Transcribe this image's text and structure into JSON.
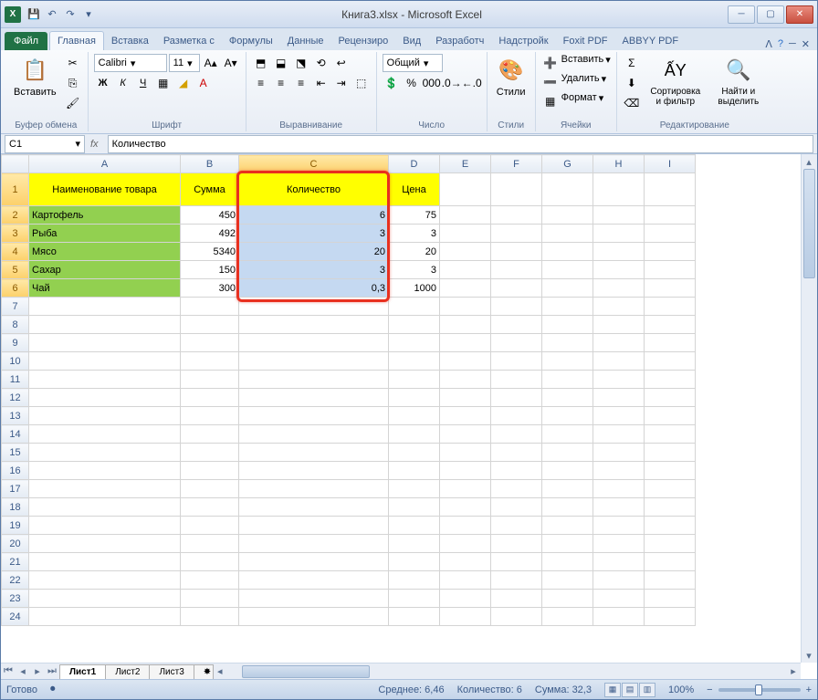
{
  "title": "Книга3.xlsx - Microsoft Excel",
  "tabs": {
    "file": "Файл",
    "home": "Главная",
    "insert": "Вставка",
    "layout": "Разметка с",
    "formulas": "Формулы",
    "data": "Данные",
    "review": "Рецензиро",
    "view": "Вид",
    "dev": "Разработч",
    "addons": "Надстройк",
    "foxit": "Foxit PDF",
    "abbyy": "ABBYY PDF"
  },
  "ribbon": {
    "clipboard": {
      "label": "Буфер обмена",
      "paste": "Вставить"
    },
    "font": {
      "label": "Шрифт",
      "name": "Calibri",
      "size": "11"
    },
    "align": {
      "label": "Выравнивание"
    },
    "number": {
      "label": "Число",
      "format": "Общий"
    },
    "styles": {
      "label": "Стили",
      "btn": "Стили"
    },
    "cells": {
      "label": "Ячейки",
      "insert": "Вставить",
      "delete": "Удалить",
      "format": "Формат"
    },
    "editing": {
      "label": "Редактирование",
      "sort": "Сортировка и фильтр",
      "find": "Найти и выделить"
    }
  },
  "namebox": "C1",
  "formula": "Количество",
  "cols": [
    "A",
    "B",
    "C",
    "D",
    "E",
    "F",
    "G",
    "H",
    "I"
  ],
  "rows": [
    "1",
    "2",
    "3",
    "4",
    "5",
    "6",
    "7",
    "8",
    "9",
    "10",
    "11",
    "12",
    "13",
    "14",
    "15",
    "16",
    "17",
    "18",
    "19",
    "20",
    "21",
    "22",
    "23",
    "24"
  ],
  "headers": {
    "A": "Наименование товара",
    "B": "Сумма",
    "C": "Количество",
    "D": "Цена"
  },
  "data": [
    {
      "A": "Картофель",
      "B": "450",
      "C": "6",
      "D": "75"
    },
    {
      "A": "Рыба",
      "B": "492",
      "C": "3",
      "D": "3"
    },
    {
      "A": "Мясо",
      "B": "5340",
      "C": "20",
      "D": "20"
    },
    {
      "A": "Сахар",
      "B": "150",
      "C": "3",
      "D": "3"
    },
    {
      "A": "Чай",
      "B": "300",
      "C": "0,3",
      "D": "1000"
    }
  ],
  "sheets": {
    "s1": "Лист1",
    "s2": "Лист2",
    "s3": "Лист3"
  },
  "status": {
    "ready": "Готово",
    "avg": "Среднее: 6,46",
    "count": "Количество: 6",
    "sum": "Сумма: 32,3",
    "zoom": "100%"
  }
}
